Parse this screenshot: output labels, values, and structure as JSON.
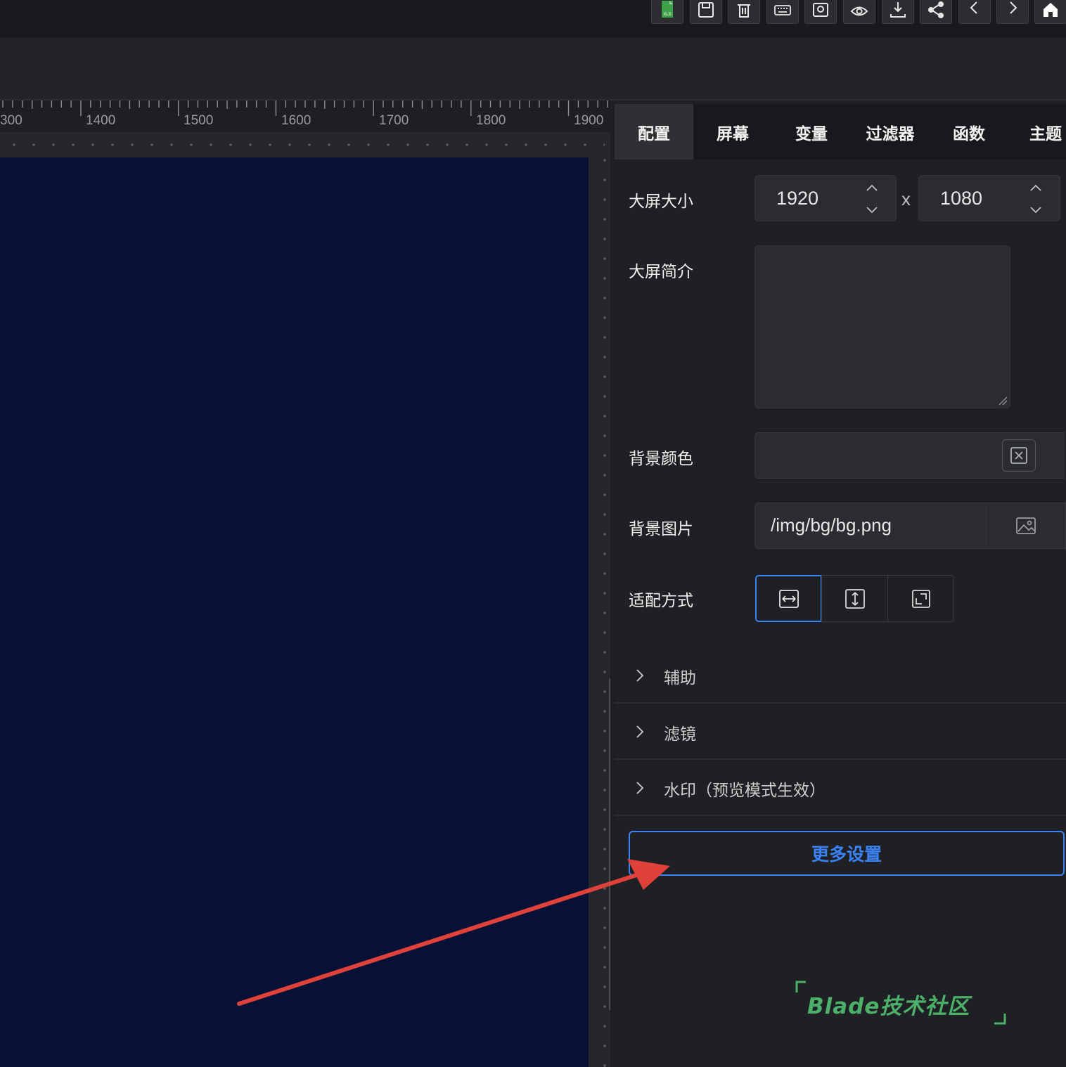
{
  "toolbar": {
    "icons": [
      "xls-export-icon",
      "save-icon",
      "delete-icon",
      "keyboard-icon",
      "screenshot-icon",
      "preview-eye-icon",
      "download-icon",
      "share-icon",
      "undo-icon",
      "redo-icon",
      "home-icon"
    ],
    "xls_badge": "XLS"
  },
  "ruler": {
    "labels": [
      "300",
      "1400",
      "1500",
      "1600",
      "1700",
      "1800",
      "1900"
    ]
  },
  "panel": {
    "tabs": [
      "配置",
      "屏幕",
      "变量",
      "过滤器",
      "函数",
      "主题"
    ],
    "active_tab": "配置",
    "fields": {
      "size_label": "大屏大小",
      "width": "1920",
      "times": "x",
      "height": "1080",
      "intro_label": "大屏简介",
      "intro_value": "",
      "bg_color_label": "背景颜色",
      "bg_color_value": "",
      "bg_image_label": "背景图片",
      "bg_image_value": "/img/bg/bg.png",
      "fit_label": "适配方式",
      "fit_options": [
        "fit-width-icon",
        "fit-height-icon",
        "fit-full-icon"
      ],
      "fit_selected": "fit-width-icon"
    },
    "collapses": [
      "辅助",
      "滤镜",
      "水印（预览模式生效）"
    ],
    "more_button": "更多设置"
  },
  "watermark": {
    "text": "Blade技术社区"
  },
  "colors": {
    "accent": "#3b82f6",
    "stage": "#071135",
    "watermark": "#4caf6a",
    "arrow": "#e0413a"
  }
}
